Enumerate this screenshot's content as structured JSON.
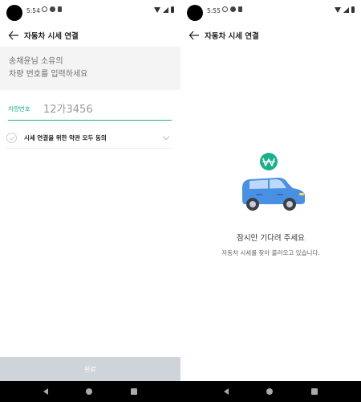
{
  "left_screen": {
    "status": {
      "time": "5:54"
    },
    "app_bar": {
      "title": "자동차 시세 연결"
    },
    "instruction": {
      "line1": "송채윤님 소유의",
      "line2": "차량 번호를 입력하세요"
    },
    "plate": {
      "label": "차량번호",
      "value": "12가3456"
    },
    "agreement": {
      "label": "시세 연결을 위한 약관 모두 동의"
    },
    "complete_button": {
      "label": "완료"
    }
  },
  "right_screen": {
    "status": {
      "time": "5:55"
    },
    "app_bar": {
      "title": "자동차 시세 연결"
    },
    "loading": {
      "title": "잠시만 기다려 주세요",
      "subtitle": "자동차 시세를 찾아 불러오고 있습니다."
    }
  },
  "colors": {
    "accent": "#1bb089",
    "button_disabled": "#cfd3da",
    "car_blue": "#4a90e2"
  },
  "icons": [
    "back-arrow-icon",
    "check-circle-icon",
    "chevron-down-icon",
    "won-badge-icon",
    "car-icon"
  ]
}
